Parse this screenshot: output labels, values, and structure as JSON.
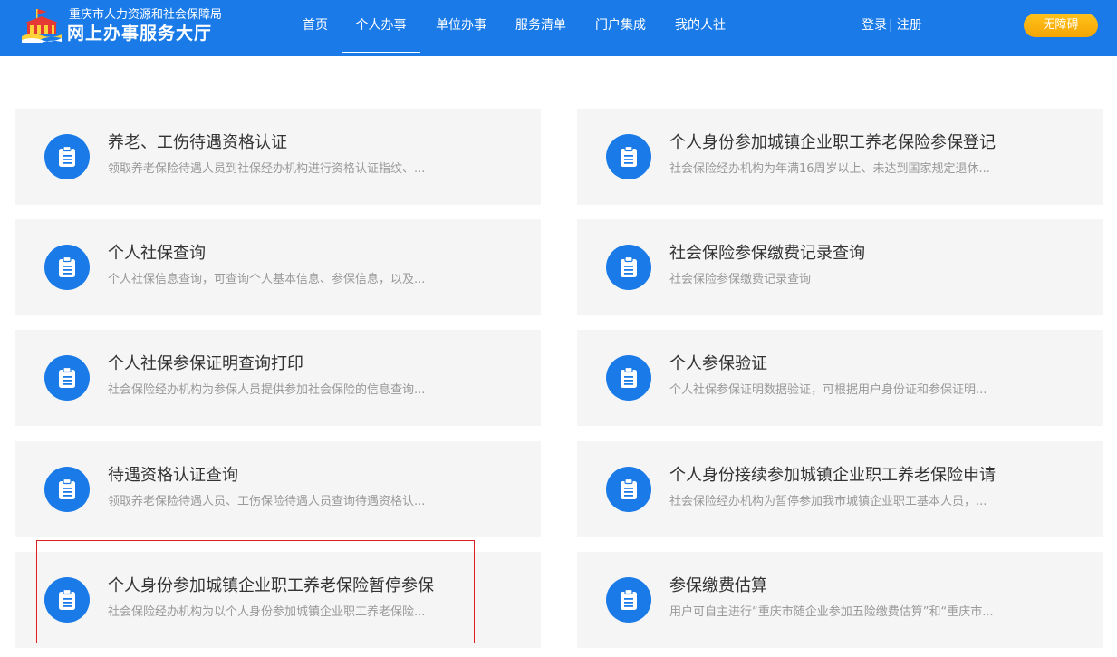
{
  "header": {
    "org_name": "重庆市人力资源和社会保障局",
    "site_name": "网上办事服务大厅",
    "nav": [
      {
        "label": "首页"
      },
      {
        "label": "个人办事",
        "active": true
      },
      {
        "label": "单位办事"
      },
      {
        "label": "服务清单"
      },
      {
        "label": "门户集成"
      },
      {
        "label": "我的人社"
      }
    ],
    "login": "登录",
    "separator": "|",
    "register": "注册",
    "accessibility": "无障碍"
  },
  "services": [
    {
      "title": "养老、工伤待遇资格认证",
      "desc": "领取养老保险待遇人员到社保经办机构进行资格认证指纹、..."
    },
    {
      "title": "个人身份参加城镇企业职工养老保险参保登记",
      "desc": "社会保险经办机构为年满16周岁以上、未达到国家规定退休..."
    },
    {
      "title": "个人社保查询",
      "desc": "个人社保信息查询，可查询个人基本信息、参保信息，以及..."
    },
    {
      "title": "社会保险参保缴费记录查询",
      "desc": "社会保险参保缴费记录查询"
    },
    {
      "title": "个人社保参保证明查询打印",
      "desc": "社会保险经办机构为参保人员提供参加社会保险的信息查询..."
    },
    {
      "title": "个人参保验证",
      "desc": "个人社保参保证明数据验证，可根据用户身份证和参保证明..."
    },
    {
      "title": "待遇资格认证查询",
      "desc": "领取养老保险待遇人员、工伤保险待遇人员查询待遇资格认..."
    },
    {
      "title": "个人身份接续参加城镇企业职工养老保险申请",
      "desc": "社会保险经办机构为暂停参加我市城镇企业职工基本人员，..."
    },
    {
      "title": "个人身份参加城镇企业职工养老保险暂停参保",
      "desc": "社会保险经办机构为以个人身份参加城镇企业职工养老保险...",
      "highlighted": true
    },
    {
      "title": "参保缴费估算",
      "desc": "用户可自主进行“重庆市随企业参加五险缴费估算”和“重庆市..."
    }
  ],
  "colors": {
    "brand_blue": "#1a7be8",
    "accent_orange": "#f5a500",
    "card_bg": "#f5f5f5",
    "highlight_red": "#e02020"
  },
  "icons": {
    "logo": "city-gate-logo-icon",
    "service": "clipboard-icon"
  }
}
